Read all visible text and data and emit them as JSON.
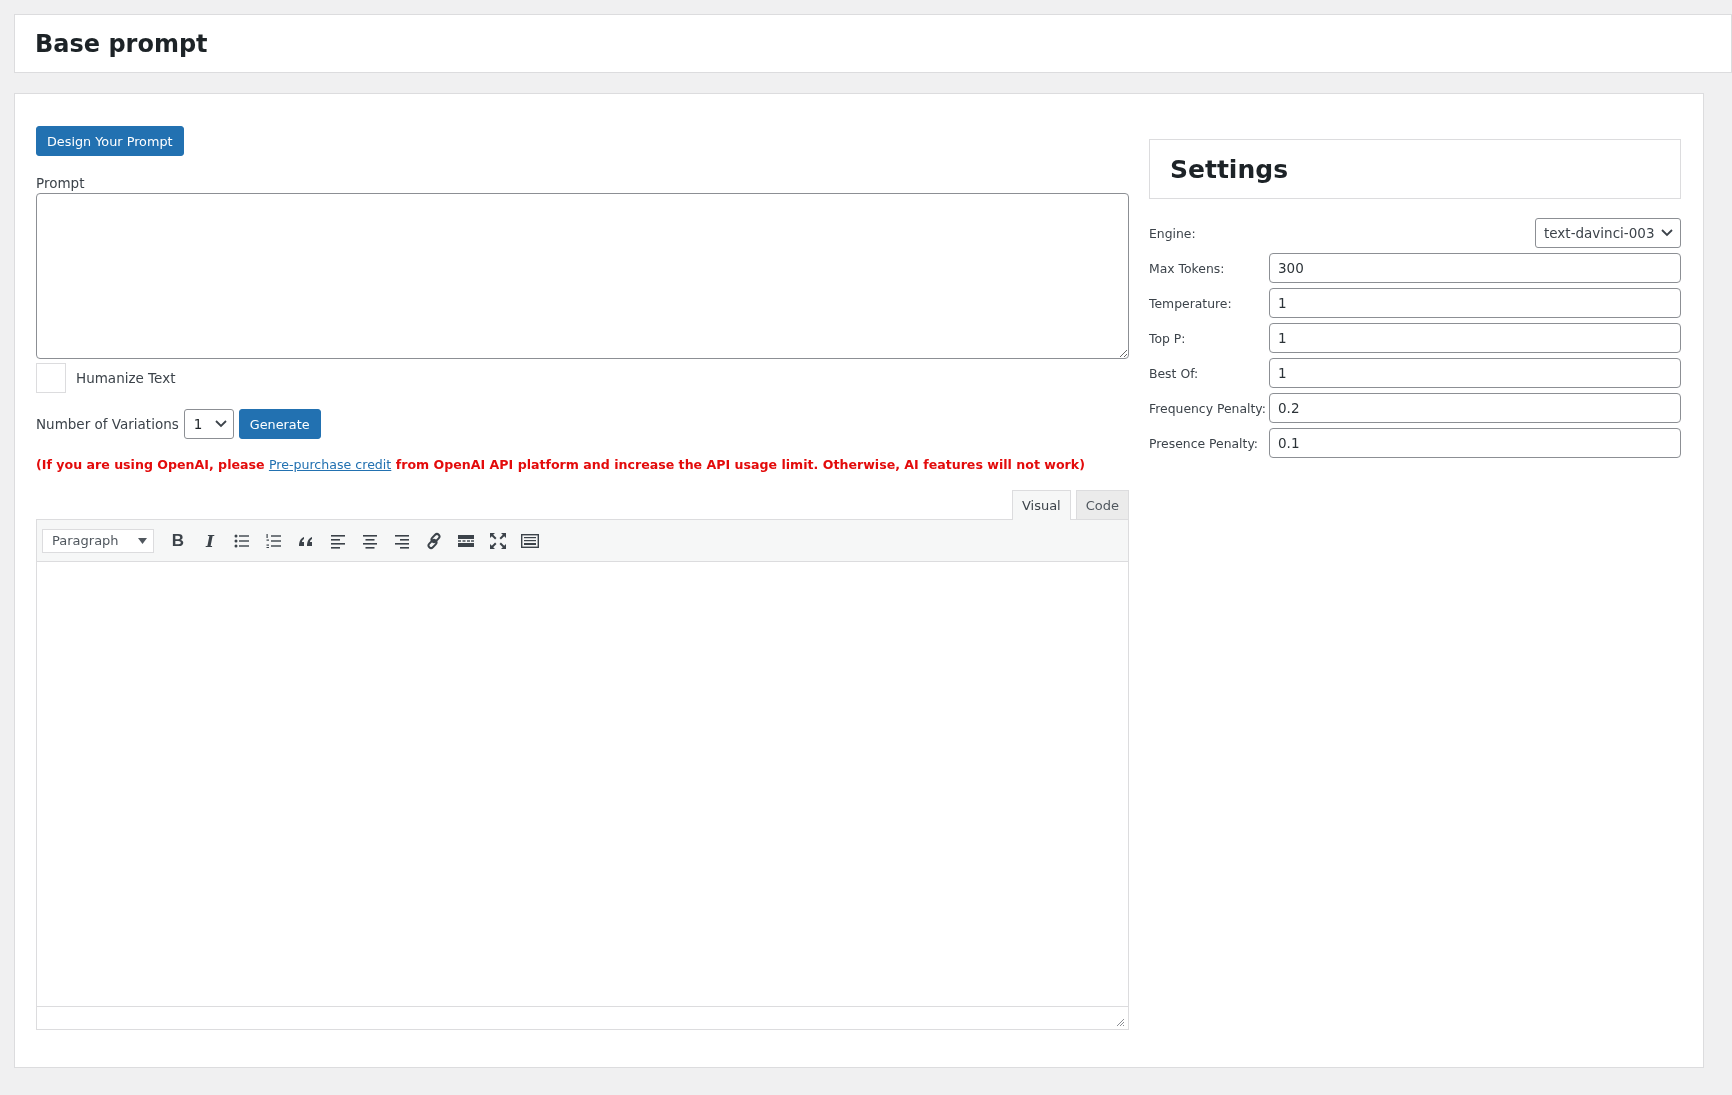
{
  "page_title": "Base prompt",
  "prompt_form": {
    "design_button": "Design Your Prompt",
    "prompt_label": "Prompt",
    "humanize": {
      "label": "Humanize Text",
      "checked": false
    },
    "variations": {
      "label": "Number of Variations",
      "value": "1"
    },
    "generate_button": "Generate",
    "notice": {
      "before": "(If you are using OpenAI, please ",
      "link": "Pre-purchase credit",
      "after": " from OpenAI API platform and increase the API usage limit. Otherwise, AI features will not work)"
    }
  },
  "editor": {
    "tabs": [
      {
        "label": "Visual",
        "selected": true
      },
      {
        "label": "Code",
        "selected": false
      }
    ],
    "format": "Paragraph",
    "tools": [
      {
        "kind": "bold",
        "glyph": "B"
      },
      {
        "kind": "italic",
        "glyph": "I"
      },
      {
        "kind": "bullet-list"
      },
      {
        "kind": "numbered-list"
      },
      {
        "kind": "quote"
      },
      {
        "kind": "align-left"
      },
      {
        "kind": "align-center"
      },
      {
        "kind": "align-right"
      },
      {
        "kind": "link"
      },
      {
        "kind": "read-more"
      },
      {
        "kind": "fullscreen"
      },
      {
        "kind": "keyboard"
      }
    ]
  },
  "settings": {
    "title": "Settings",
    "engine": {
      "label": "Engine:",
      "value": "text-davinci-003"
    },
    "fields": [
      {
        "label": "Max Tokens:",
        "value": "300"
      },
      {
        "label": "Temperature:",
        "value": "1"
      },
      {
        "label": "Top P:",
        "value": "1"
      },
      {
        "label": "Best Of:",
        "value": "1"
      },
      {
        "label": "Frequency Penalty:",
        "value": "0.2"
      },
      {
        "label": "Presence Penalty:",
        "value": "0.1"
      }
    ]
  }
}
